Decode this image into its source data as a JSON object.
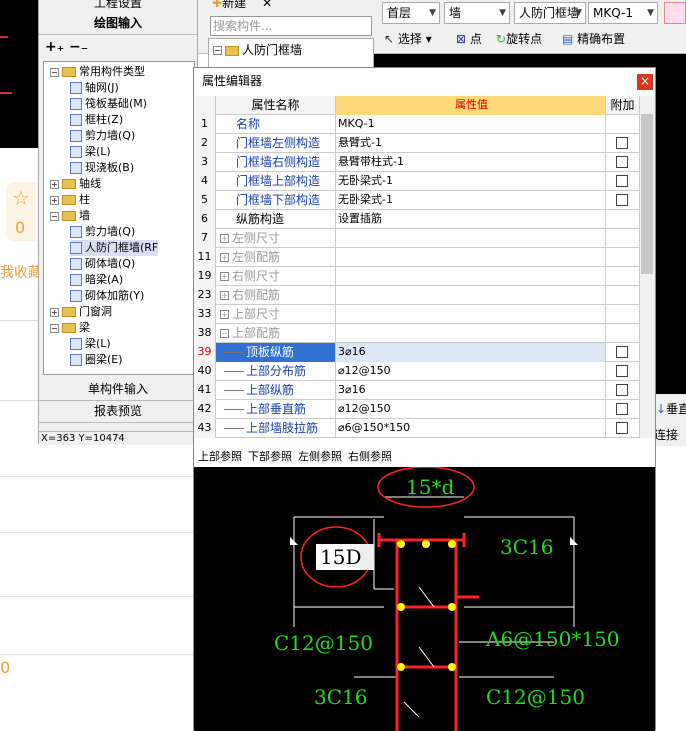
{
  "left_panel": {
    "favorite_count": "0",
    "favorite_text": "我收藏",
    "red_text": "0"
  },
  "tree_panel": {
    "tab_top": "工程设置",
    "tab_draw": "绘图输入",
    "tab_single": "单构件输入",
    "tab_report": "报表预览",
    "coords": "X=363 Y=10474",
    "items": [
      {
        "label": "常用构件类型",
        "level": 0,
        "toggle": "−",
        "folder": true
      },
      {
        "label": "轴网(J)",
        "level": 1
      },
      {
        "label": "筏板基础(M)",
        "level": 1
      },
      {
        "label": "框柱(Z)",
        "level": 1
      },
      {
        "label": "剪力墙(Q)",
        "level": 1
      },
      {
        "label": "梁(L)",
        "level": 1
      },
      {
        "label": "现浇板(B)",
        "level": 1
      },
      {
        "label": "轴线",
        "level": 0,
        "toggle": "+",
        "folder": true
      },
      {
        "label": "柱",
        "level": 0,
        "toggle": "+",
        "folder": true
      },
      {
        "label": "墙",
        "level": 0,
        "toggle": "−",
        "folder": true
      },
      {
        "label": "剪力墙(Q)",
        "level": 1
      },
      {
        "label": "人防门框墙(RF",
        "level": 1,
        "selected": true
      },
      {
        "label": "砌体墙(Q)",
        "level": 1
      },
      {
        "label": "暗梁(A)",
        "level": 1
      },
      {
        "label": "砌体加筋(Y)",
        "level": 1
      },
      {
        "label": "门窗洞",
        "level": 0,
        "toggle": "+",
        "folder": true
      },
      {
        "label": "梁",
        "level": 0,
        "toggle": "−",
        "folder": true
      },
      {
        "label": "梁(L)",
        "level": 1
      },
      {
        "label": "圈梁(E)",
        "level": 1
      }
    ]
  },
  "toolbar": {
    "new_label": "新建",
    "search_placeholder": "搜索构件...",
    "floor": "首层",
    "category": "墙",
    "type": "人防门框墙",
    "component": "MKQ-1",
    "select": "选择",
    "point": "点",
    "rotate_point": "旋转点",
    "precise_layout": "精确布置",
    "tree_node": "人防门框墙",
    "tree_child": "MKQ-1"
  },
  "editor": {
    "title": "属性编辑器",
    "close": "×",
    "headers": {
      "name": "属性名称",
      "value": "属性值",
      "extra": "附加"
    },
    "rows": [
      {
        "n": "1",
        "name": "名称",
        "value": "MKQ-1",
        "cb": false
      },
      {
        "n": "2",
        "name": "门框墙左侧构造",
        "value": "悬臂式-1",
        "cb": true
      },
      {
        "n": "3",
        "name": "门框墙右侧构造",
        "value": "悬臂带柱式-1",
        "cb": true
      },
      {
        "n": "4",
        "name": "门框墙上部构造",
        "value": "无卧梁式-1",
        "cb": true
      },
      {
        "n": "5",
        "name": "门框墙下部构造",
        "value": "无卧梁式-1",
        "cb": true
      },
      {
        "n": "6",
        "name": "纵筋构造",
        "value": "设置插筋",
        "cb": false
      },
      {
        "n": "7",
        "name": "左侧尺寸",
        "value": "",
        "toggle": "+"
      },
      {
        "n": "11",
        "name": "左侧配筋",
        "value": "",
        "toggle": "+"
      },
      {
        "n": "19",
        "name": "右侧尺寸",
        "value": "",
        "toggle": "+"
      },
      {
        "n": "23",
        "name": "右侧配筋",
        "value": "",
        "toggle": "+"
      },
      {
        "n": "33",
        "name": "上部尺寸",
        "value": "",
        "toggle": "+"
      },
      {
        "n": "38",
        "name": "上部配筋",
        "value": "",
        "toggle": "−"
      },
      {
        "n": "39",
        "name": "顶板纵筋",
        "value": "3⌀16",
        "cb": true
      },
      {
        "n": "40",
        "name": "上部分布筋",
        "value": "⌀12@150",
        "cb": true
      },
      {
        "n": "41",
        "name": "上部纵筋",
        "value": "3⌀16",
        "cb": true
      },
      {
        "n": "42",
        "name": "上部垂直筋",
        "value": "⌀12@150",
        "cb": true
      },
      {
        "n": "43",
        "name": "上部墙肢拉筋",
        "value": "⌀6@150*150",
        "cb": true
      }
    ],
    "tabs": [
      "上部参照",
      "下部参照",
      "左侧参照",
      "右侧参照"
    ],
    "drawing": {
      "dim_top": "15*d",
      "dim_left": "15D",
      "label_3c16_top": "3C16",
      "label_c12_left": "C12@150",
      "label_a6": "A6@150*150",
      "label_3c16_bottom": "3C16",
      "label_c12_bottom": "C12@150"
    }
  },
  "right_strip": {
    "btn1": "垂直",
    "btn2": "连接"
  }
}
